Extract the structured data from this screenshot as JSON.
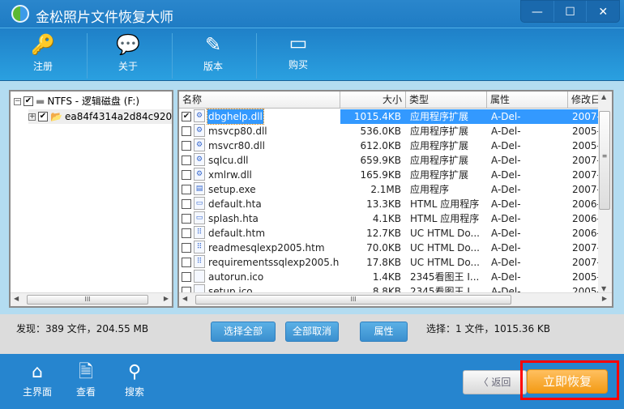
{
  "app": {
    "title": "金松照片文件恢复大师"
  },
  "window_controls": {
    "minimize": "—",
    "maximize": "☐",
    "close": "✕"
  },
  "toolbar": [
    {
      "label": "注册",
      "icon": "key-icon"
    },
    {
      "label": "关于",
      "icon": "chat-icon"
    },
    {
      "label": "版本",
      "icon": "glue-icon"
    },
    {
      "label": "购买",
      "icon": "card-icon"
    }
  ],
  "tree": {
    "root": {
      "label": "NTFS - 逻辑磁盘 (F:)",
      "checked": true,
      "expanded": true
    },
    "child": {
      "label": "ea84f4314a2d84c920",
      "checked": true,
      "expanded": false
    }
  },
  "list": {
    "columns": {
      "name": "名称",
      "size": "大小",
      "type": "类型",
      "attr": "属性",
      "date": "修改日"
    },
    "rows": [
      {
        "name": "dbghelp.dll",
        "size": "1015.4KB",
        "type": "应用程序扩展",
        "attr": "A-Del-",
        "date": "2007-",
        "checked": true,
        "selected": true,
        "icon": "dll"
      },
      {
        "name": "msvcp80.dll",
        "size": "536.0KB",
        "type": "应用程序扩展",
        "attr": "A-Del-",
        "date": "2005-",
        "icon": "dll"
      },
      {
        "name": "msvcr80.dll",
        "size": "612.0KB",
        "type": "应用程序扩展",
        "attr": "A-Del-",
        "date": "2005-",
        "icon": "dll"
      },
      {
        "name": "sqlcu.dll",
        "size": "659.9KB",
        "type": "应用程序扩展",
        "attr": "A-Del-",
        "date": "2007-",
        "icon": "dll"
      },
      {
        "name": "xmlrw.dll",
        "size": "165.9KB",
        "type": "应用程序扩展",
        "attr": "A-Del-",
        "date": "2007-",
        "icon": "dll"
      },
      {
        "name": "setup.exe",
        "size": "2.1MB",
        "type": "应用程序",
        "attr": "A-Del-",
        "date": "2007-",
        "icon": "exe"
      },
      {
        "name": "default.hta",
        "size": "13.3KB",
        "type": "HTML 应用程序",
        "attr": "A-Del-",
        "date": "2006-",
        "icon": "hta"
      },
      {
        "name": "splash.hta",
        "size": "4.1KB",
        "type": "HTML 应用程序",
        "attr": "A-Del-",
        "date": "2006-",
        "icon": "hta"
      },
      {
        "name": "default.htm",
        "size": "12.7KB",
        "type": "UC HTML Do...",
        "attr": "A-Del-",
        "date": "2006-",
        "icon": "htm"
      },
      {
        "name": "readmesqlexp2005.htm",
        "size": "70.0KB",
        "type": "UC HTML Do...",
        "attr": "A-Del-",
        "date": "2007-",
        "icon": "htm"
      },
      {
        "name": "requirementssqlexp2005.h...",
        "size": "17.8KB",
        "type": "UC HTML Do...",
        "attr": "A-Del-",
        "date": "2007-",
        "icon": "htm"
      },
      {
        "name": "autorun.ico",
        "size": "1.4KB",
        "type": "2345看图王 I...",
        "attr": "A-Del-",
        "date": "2005-",
        "icon": "ico"
      },
      {
        "name": "setup.ico",
        "size": "8.8KB",
        "type": "2345看图王 I...",
        "attr": "A-Del-",
        "date": "2005-",
        "icon": "ico"
      }
    ]
  },
  "status": {
    "found": "发现：389 文件，204.55 MB",
    "selected": "选择：1 文件，1015.36 KB",
    "select_all": "选择全部",
    "deselect_all": "全部取消",
    "properties": "属性"
  },
  "bottom": {
    "nav": [
      {
        "label": "主界面",
        "icon": "home-icon"
      },
      {
        "label": "查看",
        "icon": "view-icon"
      },
      {
        "label": "搜索",
        "icon": "search-icon"
      }
    ],
    "back": "返回",
    "recover": "立即恢复"
  },
  "colors": {
    "title_bar": "#2a86cc",
    "bottom_bar": "#2685cf",
    "recover": "#f5a020",
    "highlight": "#ff0000",
    "selection": "#3399ff"
  }
}
